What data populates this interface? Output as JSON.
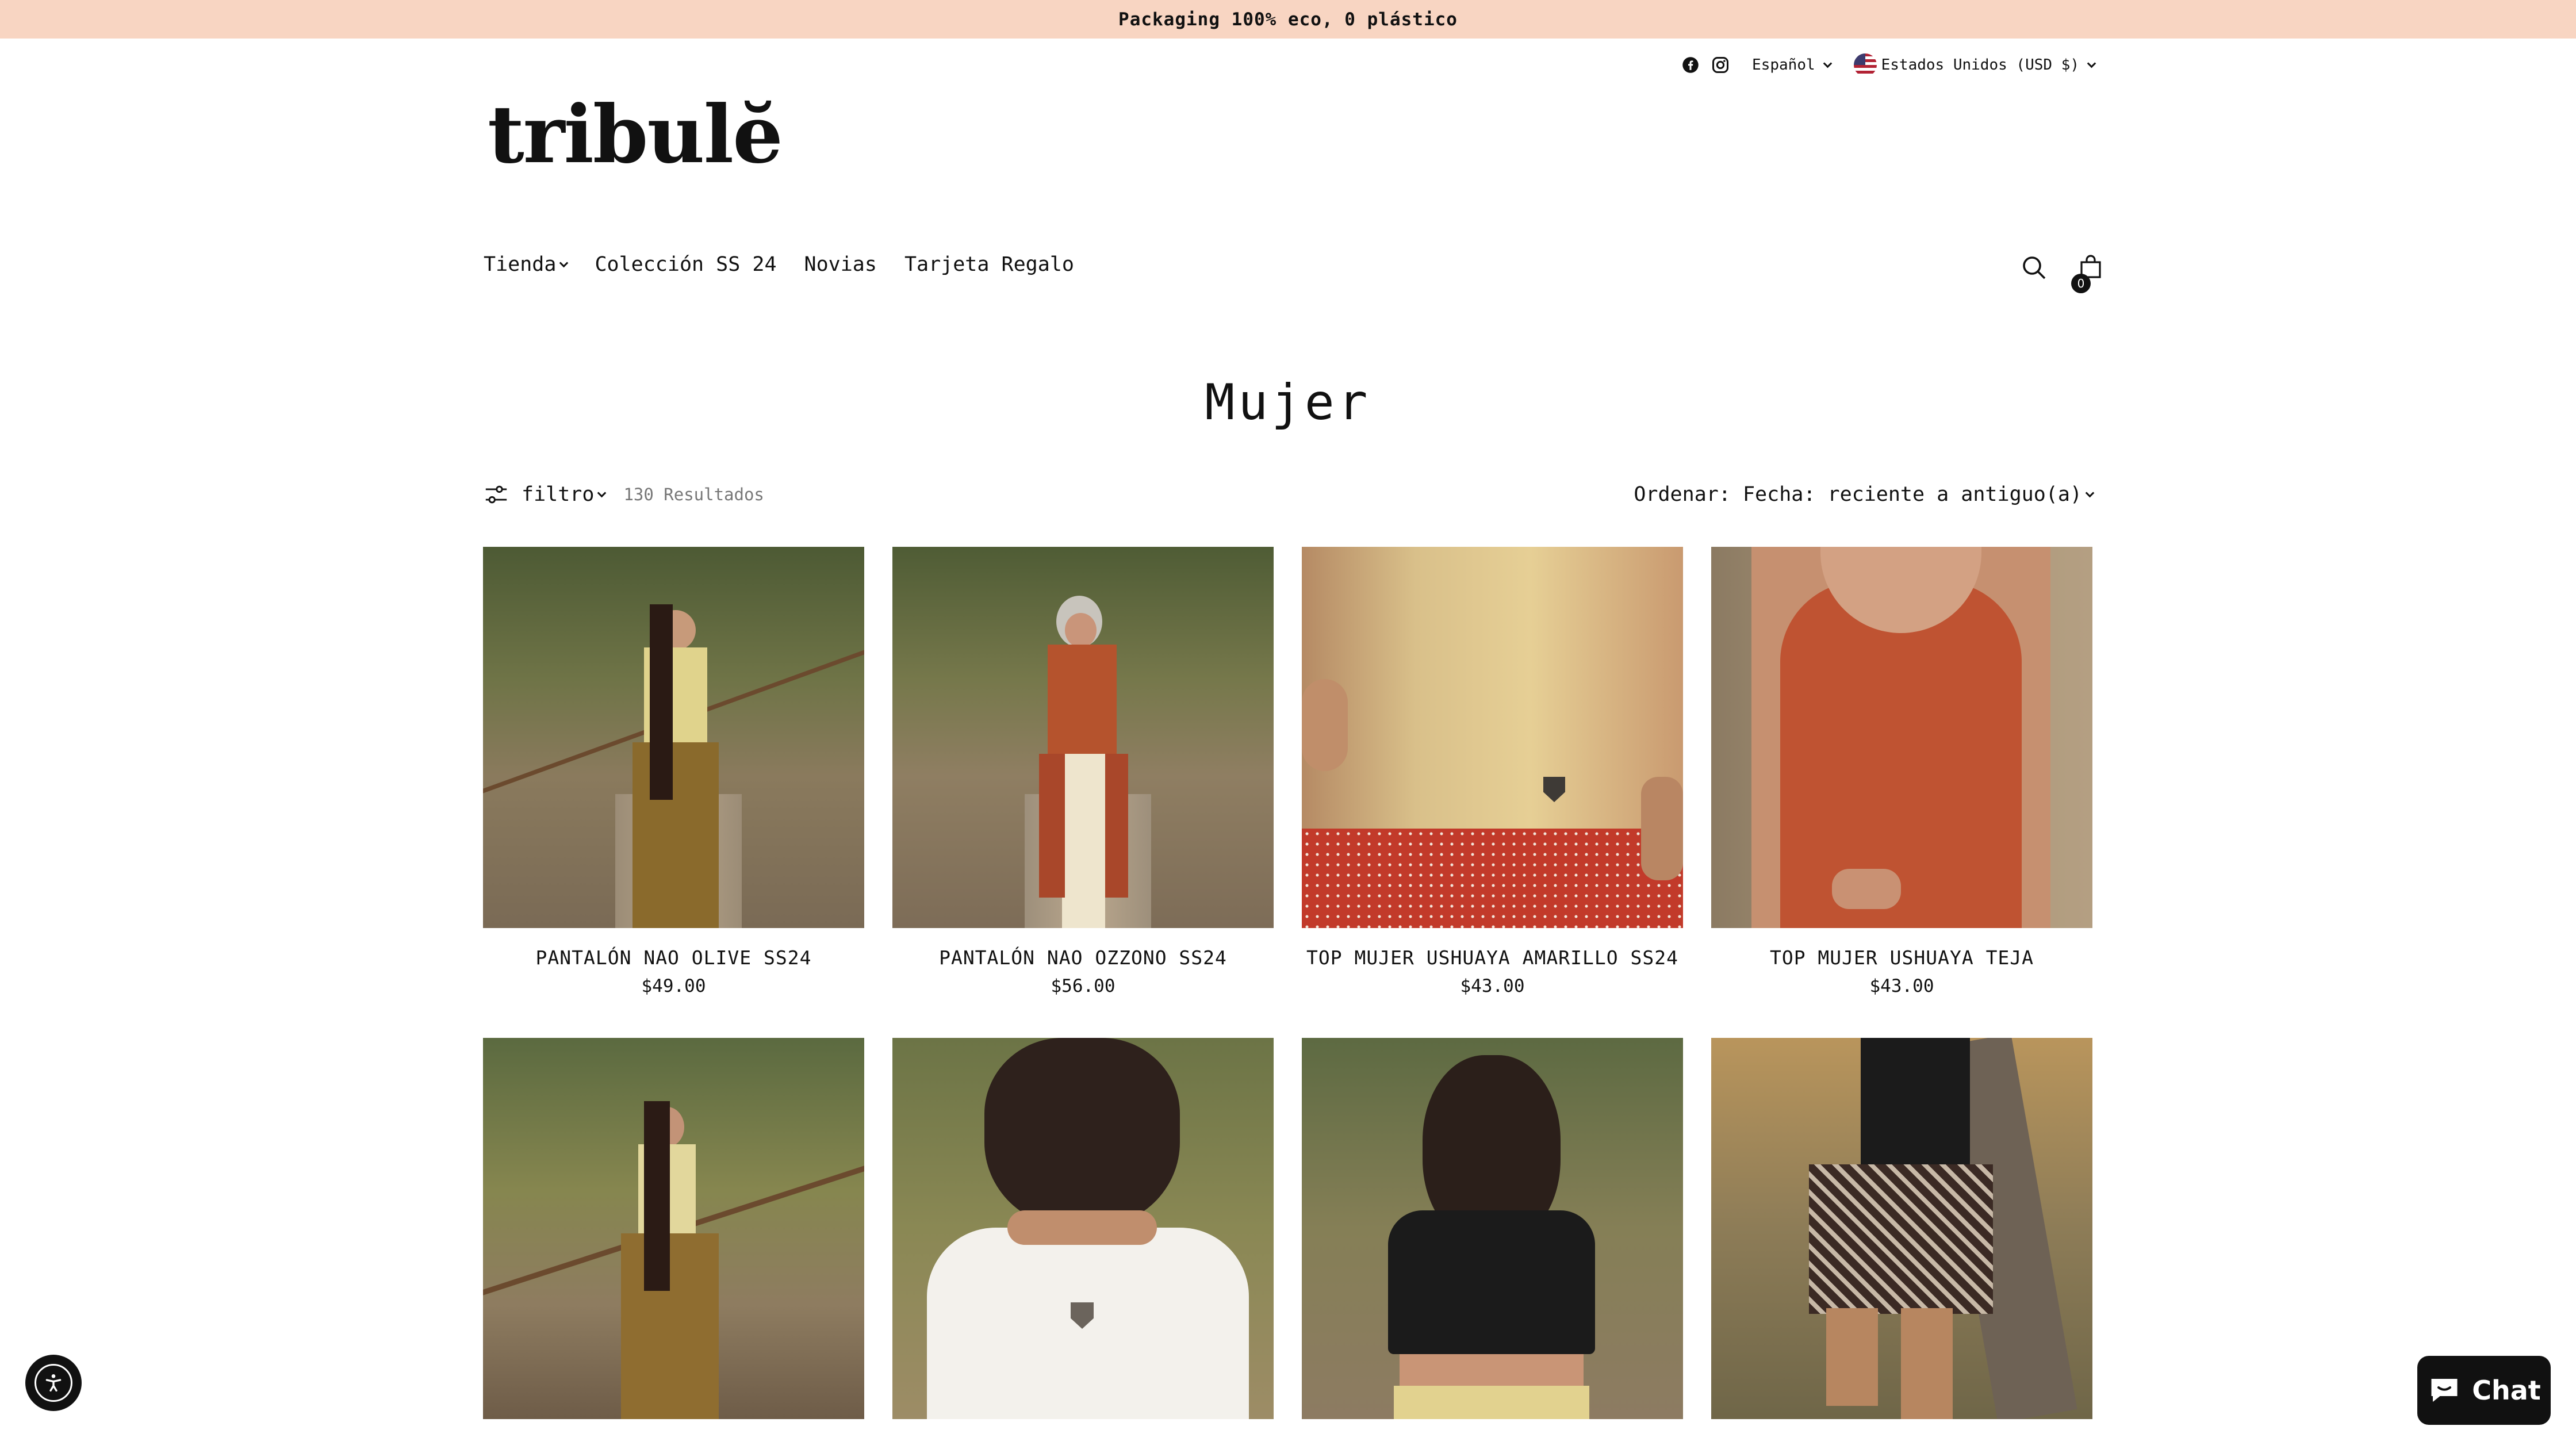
{
  "announcement": "Packaging 100% eco, 0 plástico",
  "utility": {
    "language": "Español",
    "country": "Estados Unidos (USD $)"
  },
  "logo": "tribulĕ",
  "nav": {
    "items": [
      {
        "label": "Tienda",
        "has_dropdown": true
      },
      {
        "label": "Colección SS 24"
      },
      {
        "label": "Novias"
      },
      {
        "label": "Tarjeta Regalo"
      }
    ]
  },
  "cart": {
    "count": "0"
  },
  "page": {
    "title": "Mujer"
  },
  "toolbar": {
    "filter_label": "filtro",
    "results": "130 Resultados",
    "sort_label": "Ordenar: Fecha: reciente a antiguo(a)"
  },
  "products": [
    {
      "name": "PANTALÓN NAO OLIVE SS24",
      "price": "$49.00"
    },
    {
      "name": "PANTALÓN NAO OZZONO SS24",
      "price": "$56.00"
    },
    {
      "name": "TOP MUJER USHUAYA AMARILLO SS24",
      "price": "$43.00"
    },
    {
      "name": "TOP MUJER USHUAYA TEJA",
      "price": "$43.00"
    },
    {
      "name": "",
      "price": ""
    },
    {
      "name": "",
      "price": ""
    },
    {
      "name": "",
      "price": ""
    },
    {
      "name": "",
      "price": ""
    }
  ],
  "chat": {
    "label": "Chat"
  },
  "colors": {
    "announcement_bg": "#f8d5c2",
    "text": "#111111",
    "muted": "#777777"
  }
}
